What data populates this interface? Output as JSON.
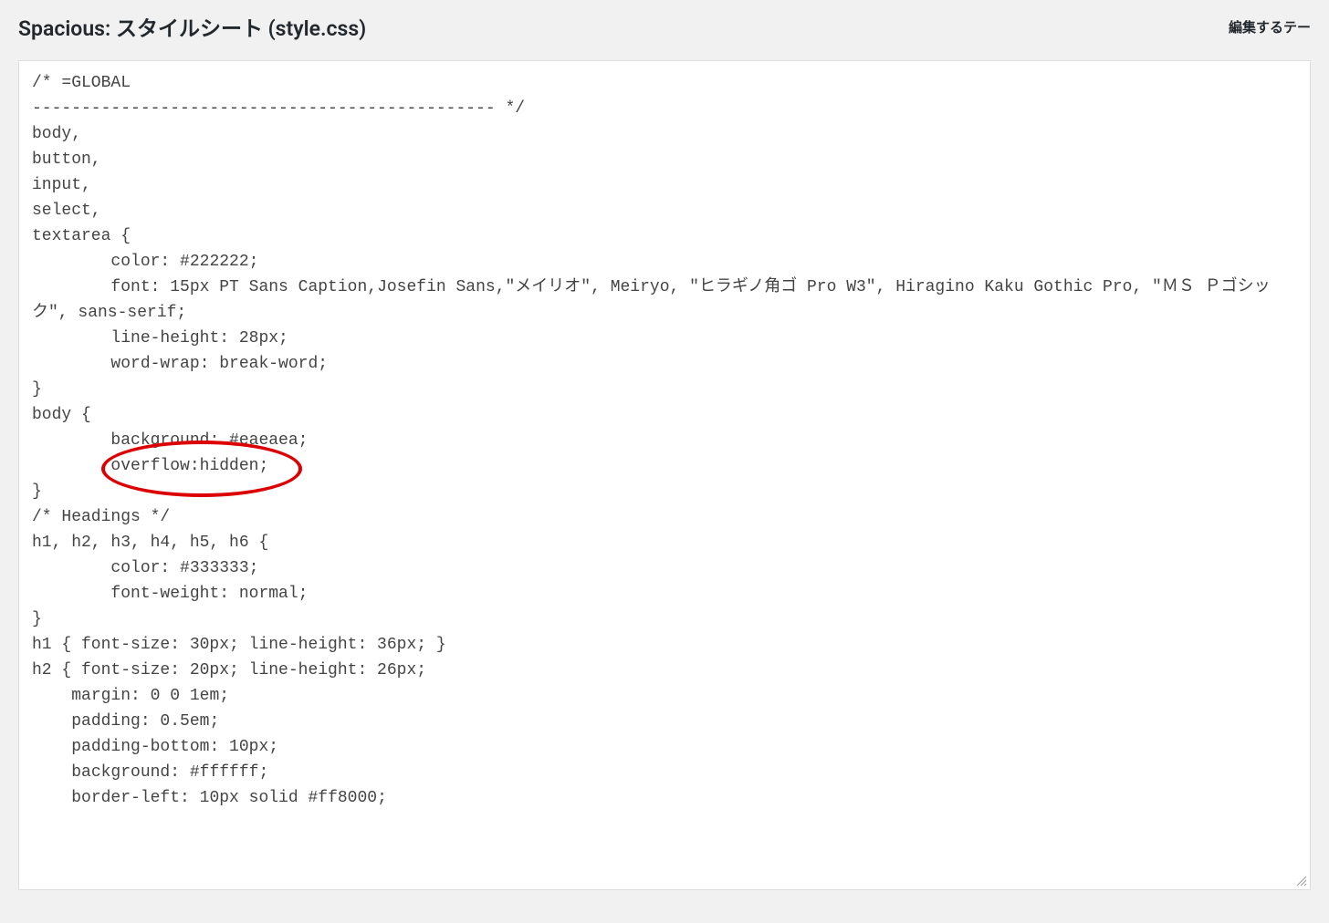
{
  "header": {
    "title": "Spacious: スタイルシート (style.css)",
    "theme_select_label": "編集するテー"
  },
  "editor": {
    "content": "/* =GLOBAL\n----------------------------------------------- */\nbody,\nbutton,\ninput,\nselect,\ntextarea {\n        color: #222222;\n        font: 15px PT Sans Caption,Josefin Sans,\"メイリオ\", Meiryo, \"ヒラギノ角ゴ Pro W3\", Hiragino Kaku Gothic Pro, \"ＭＳ Ｐゴシック\", sans-serif;\n        line-height: 28px;\n        word-wrap: break-word;\n}\nbody {\n        background: #eaeaea;\n        overflow:hidden;\n}\n/* Headings */\nh1, h2, h3, h4, h5, h6 {\n        color: #333333;\n        font-weight: normal;\n}\nh1 { font-size: 30px; line-height: 36px; }\nh2 { font-size: 20px; line-height: 26px;\n    margin: 0 0 1em;\n    padding: 0.5em;\n    padding-bottom: 10px;\n    background: #ffffff;\n    border-left: 10px solid #ff8000;\n"
  }
}
